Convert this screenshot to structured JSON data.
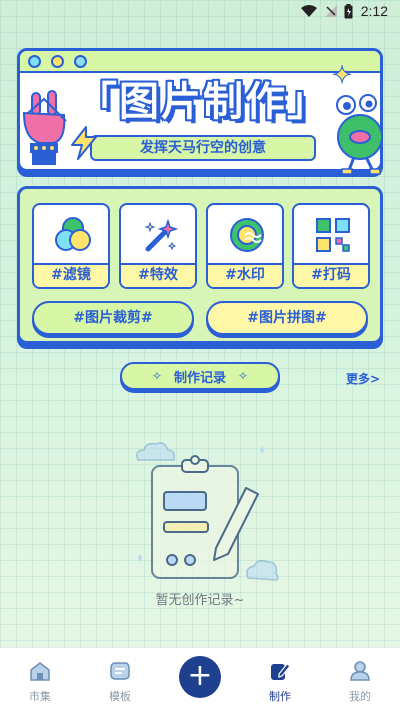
{
  "status_bar": {
    "time": "2:12"
  },
  "banner": {
    "title": "「图片制作」",
    "subtitle": "发挥天马行空的创意"
  },
  "tools": [
    {
      "label": "#滤镜",
      "icon": "filter-icon"
    },
    {
      "label": "#特效",
      "icon": "magic-wand-icon"
    },
    {
      "label": "#水印",
      "icon": "watermark-icon"
    },
    {
      "label": "#打码",
      "icon": "mosaic-icon"
    }
  ],
  "actions": {
    "crop": "#图片裁剪#",
    "collage": "#图片拼图#"
  },
  "records": {
    "title": "制作记录",
    "more": "更多>",
    "empty_text": "暂无创作记录~"
  },
  "nav": {
    "items": [
      {
        "label": "市集",
        "icon": "home-icon"
      },
      {
        "label": "模板",
        "icon": "template-icon"
      },
      {
        "label": "",
        "icon": "plus-icon"
      },
      {
        "label": "制作",
        "icon": "edit-icon"
      },
      {
        "label": "我的",
        "icon": "user-icon"
      }
    ],
    "active_index": 3
  },
  "colors": {
    "primary": "#2a5fd6",
    "navy": "#1f3f8f",
    "lime": "#d7f7a6",
    "yellow": "#fff7a8"
  }
}
